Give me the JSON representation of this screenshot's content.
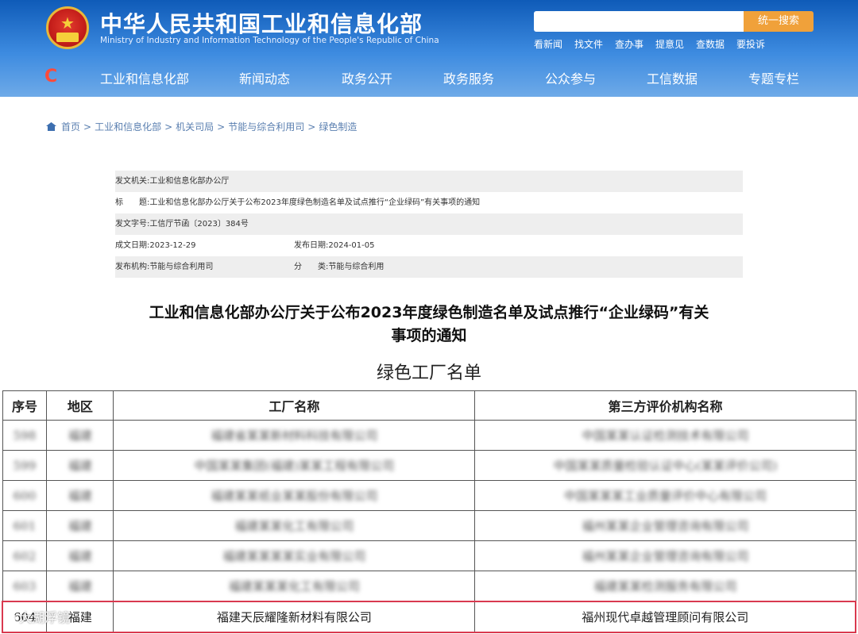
{
  "site": {
    "title": "中华人民共和国工业和信息化部",
    "subtitle": "Ministry of Industry and Information Technology of the People's Republic of China",
    "search_button": "统一搜索",
    "quick_links": [
      "看新闻",
      "找文件",
      "查办事",
      "提意见",
      "查数据",
      "要投诉"
    ]
  },
  "nav": {
    "items": [
      "工业和信息化部",
      "新闻动态",
      "政务公开",
      "政务服务",
      "公众参与",
      "工信数据",
      "专题专栏"
    ]
  },
  "breadcrumb": [
    "首页",
    "工业和信息化部",
    "机关司局",
    "节能与综合利用司",
    "绿色制造"
  ],
  "meta": {
    "issuer_label": "发文机关:",
    "issuer": "工业和信息化部办公厅",
    "title_label": "标　　题:",
    "title": "工业和信息化部办公厅关于公布2023年度绿色制造名单及试点推行“企业绿码”有关事项的通知",
    "docno_label": "发文字号:",
    "docno": "工信厅节函〔2023〕384号",
    "written_label": "成文日期:",
    "written": "2023-12-29",
    "published_label": "发布日期:",
    "published": "2024-01-05",
    "org_label": "发布机构:",
    "org": "节能与综合利用司",
    "category_label": "分　　类:",
    "category": "节能与综合利用"
  },
  "document": {
    "title_line1": "工业和信息化部办公厅关于公布2023年度绿色制造名单及试点推行“企业绿码”有关",
    "title_line2": "事项的通知",
    "list_title": "绿色工厂名单"
  },
  "table": {
    "headers": [
      "序号",
      "地区",
      "工厂名称",
      "第三方评价机构名称"
    ],
    "rows": [
      {
        "no": "598",
        "region": "福建",
        "factory": "福建省某某新材料科技有限公司",
        "agency": "中国某某认证检测技术有限公司",
        "blurred": true
      },
      {
        "no": "599",
        "region": "福建",
        "factory": "中国某某集团(福建)某某工程有限公司",
        "agency": "中国某某质量检验认证中心(某某评价公司)",
        "blurred": true
      },
      {
        "no": "600",
        "region": "福建",
        "factory": "福建某某纸业某某股份有限公司",
        "agency": "中国某某某工业质量评价中心有限公司",
        "blurred": true
      },
      {
        "no": "601",
        "region": "福建",
        "factory": "福建某某化工有限公司",
        "agency": "福州某某企业管理咨询有限公司",
        "blurred": true
      },
      {
        "no": "602",
        "region": "福建",
        "factory": "福建某某某某实业有限公司",
        "agency": "福州某某企业管理咨询有限公司",
        "blurred": true
      },
      {
        "no": "603",
        "region": "福建",
        "factory": "福建某某某化工有限公司",
        "agency": "福建某某检测服务有限公司",
        "blurred": true
      },
      {
        "no": "604",
        "region": "福建",
        "factory": "福建天辰耀隆新材料有限公司",
        "agency": "福州现代卓越管理顾问有限公司",
        "blurred": false
      }
    ]
  },
  "watermark": "大湖浮镜"
}
